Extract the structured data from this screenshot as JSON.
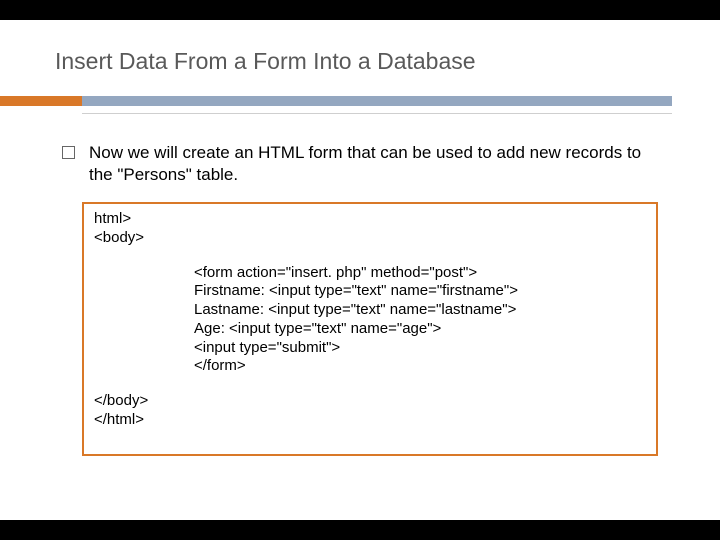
{
  "title": "Insert Data From a Form Into a Database",
  "bullet": "Now we will create an HTML form that can be used to add new records to the \"Persons\" table.",
  "code": {
    "l1": "html>",
    "l2": "<body>",
    "l3": "<form action=\"insert. php\" method=\"post\">",
    "l4": "Firstname: <input type=\"text\" name=\"firstname\">",
    "l5": "Lastname: <input type=\"text\" name=\"lastname\">",
    "l6": "Age: <input type=\"text\" name=\"age\">",
    "l7": "<input type=\"submit\">",
    "l8": "</form>",
    "l9": "</body>",
    "l10": "</html>"
  }
}
